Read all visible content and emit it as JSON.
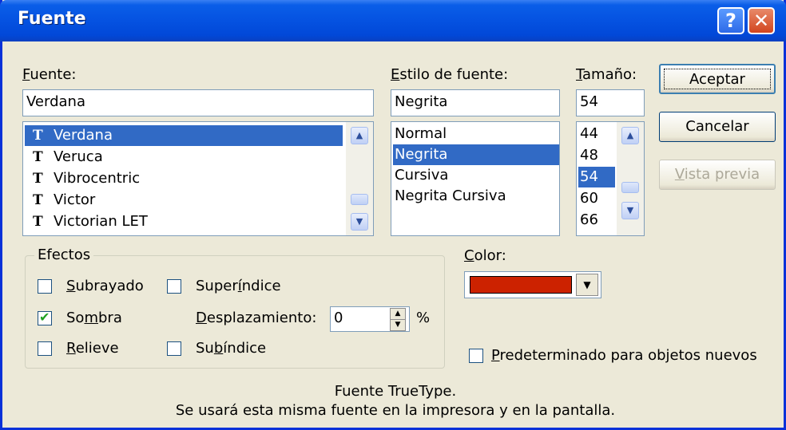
{
  "window": {
    "title": "Fuente",
    "help_icon": "question-mark",
    "close_icon": "x-mark"
  },
  "font": {
    "label": "Fuente:",
    "label_key": "F",
    "label_rest": "uente:",
    "value": "Verdana",
    "list": [
      {
        "icon": "truetype-icon",
        "name": "Verdana",
        "selected": true
      },
      {
        "icon": "truetype-icon",
        "name": "Veruca",
        "selected": false
      },
      {
        "icon": "truetype-icon",
        "name": "Vibrocentric",
        "selected": false
      },
      {
        "icon": "truetype-icon",
        "name": "Victor",
        "selected": false
      },
      {
        "icon": "truetype-icon",
        "name": "Victorian LET",
        "selected": false
      }
    ]
  },
  "style": {
    "label_key": "E",
    "label_rest": "stilo de fuente:",
    "value": "Negrita",
    "list": [
      "Normal",
      "Negrita",
      "Cursiva",
      "Negrita Cursiva"
    ],
    "selected": "Negrita"
  },
  "size": {
    "label_key": "T",
    "label_rest": "amaño:",
    "value": "54",
    "list": [
      "44",
      "48",
      "54",
      "60",
      "66"
    ],
    "selected": "54"
  },
  "buttons": {
    "ok": "Aceptar",
    "cancel": "Cancelar",
    "preview_key": "V",
    "preview_rest": "ista previa"
  },
  "effects": {
    "title": "Efectos",
    "underline_key": "S",
    "underline_rest": "ubrayado",
    "underline_checked": false,
    "shadow_pre": "So",
    "shadow_key": "m",
    "shadow_rest": "bra",
    "shadow_checked": true,
    "emboss_key": "R",
    "emboss_rest": "elieve",
    "emboss_checked": false,
    "superscript_pre": "Super",
    "superscript_key": "í",
    "superscript_rest": "ndice",
    "superscript_checked": false,
    "subscript_pre": "Su",
    "subscript_key": "b",
    "subscript_rest": "índice",
    "subscript_checked": false,
    "offset_key": "D",
    "offset_rest": "esplazamiento:",
    "offset_value": "0",
    "offset_unit": "%"
  },
  "color": {
    "label_key": "C",
    "label_rest": "olor:",
    "value": "#cc2200"
  },
  "default": {
    "label_key": "P",
    "label_rest": "redeterminado para objetos nuevos",
    "checked": false
  },
  "description": {
    "line1": "Fuente TrueType.",
    "line2": "Se usará esta misma fuente en la impresora y en la pantalla."
  }
}
